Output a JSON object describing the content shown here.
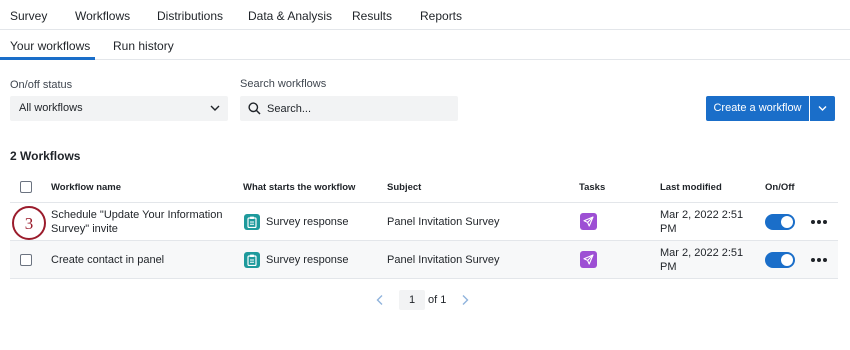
{
  "top_nav": {
    "tabs": [
      "Survey",
      "Workflows",
      "Distributions",
      "Data & Analysis",
      "Results",
      "Reports"
    ],
    "active": "Workflows"
  },
  "sub_nav": {
    "tabs": [
      "Your workflows",
      "Run history"
    ],
    "active": "Your workflows"
  },
  "filters": {
    "status_label": "On/off status",
    "status_value": "All workflows",
    "search_label": "Search workflows",
    "search_placeholder": "Search..."
  },
  "actions": {
    "create_label": "Create a workflow"
  },
  "list": {
    "count_title": "2 Workflows",
    "columns": [
      "Workflow name",
      "What starts the workflow",
      "Subject",
      "Tasks",
      "Last modified",
      "On/Off"
    ],
    "rows": [
      {
        "name_line1": "Schedule \"Update Your Information",
        "name_line2": "Survey\" invite",
        "trigger": "Survey response",
        "subject": "Panel Invitation Survey",
        "modified_line1": "Mar 2, 2022 2:51",
        "modified_line2": "PM",
        "enabled": true
      },
      {
        "name_line1": "Create contact in panel",
        "name_line2": "",
        "trigger": "Survey response",
        "subject": "Panel Invitation Survey",
        "modified_line1": "Mar 2, 2022 2:51",
        "modified_line2": "PM",
        "enabled": true
      }
    ]
  },
  "step_marker": "3",
  "pagination": {
    "current": "1",
    "of_label": "of 1"
  },
  "colors": {
    "accent": "#1a6ec9",
    "trigger_icon": "#1e9a9c",
    "task_icon": "#9d4fd4",
    "step_marker": "#9b1c2c"
  }
}
